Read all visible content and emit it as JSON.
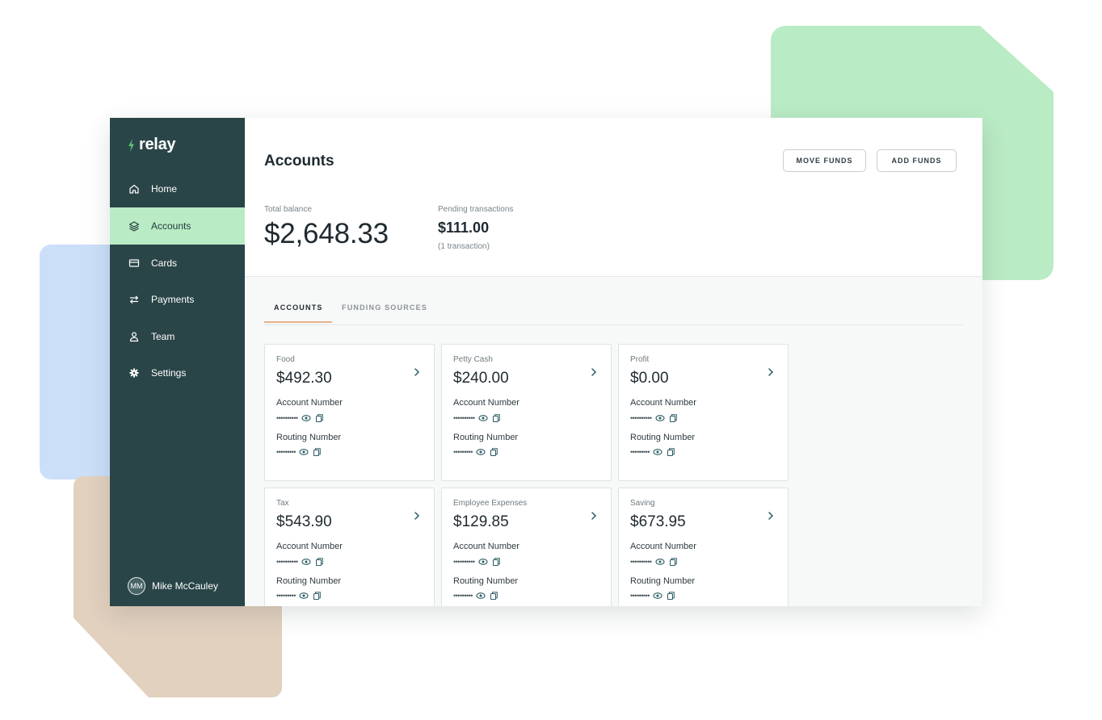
{
  "brand": {
    "name": "relay",
    "accent": "#5cc36f"
  },
  "sidebar": {
    "background": "#2a4548",
    "active_color": "#b9ebc4",
    "items": [
      {
        "label": "Home",
        "icon": "home-icon"
      },
      {
        "label": "Accounts",
        "icon": "layers-icon",
        "active": true
      },
      {
        "label": "Cards",
        "icon": "card-icon"
      },
      {
        "label": "Payments",
        "icon": "transfer-icon"
      },
      {
        "label": "Team",
        "icon": "person-icon"
      },
      {
        "label": "Settings",
        "icon": "gear-icon"
      }
    ],
    "user": {
      "initials": "MM",
      "name": "Mike McCauley"
    }
  },
  "header": {
    "title": "Accounts",
    "move_funds_label": "MOVE FUNDS",
    "add_funds_label": "ADD FUNDS",
    "total_balance_label": "Total balance",
    "total_balance_value": "$2,648.33",
    "pending_label": "Pending transactions",
    "pending_value": "$111.00",
    "pending_note": "(1 transaction)"
  },
  "tabs": [
    {
      "label": "ACCOUNTS",
      "active": true
    },
    {
      "label": "FUNDING SOURCES",
      "active": false
    }
  ],
  "accounts": [
    {
      "name": "Food",
      "balance": "$492.30",
      "account_label": "Account Number",
      "account_masked": "••••••••••",
      "routing_label": "Routing Number",
      "routing_masked": "•••••••••"
    },
    {
      "name": "Petty Cash",
      "balance": "$240.00",
      "account_label": "Account Number",
      "account_masked": "••••••••••",
      "routing_label": "Routing Number",
      "routing_masked": "•••••••••"
    },
    {
      "name": "Profit",
      "balance": "$0.00",
      "account_label": "Account Number",
      "account_masked": "••••••••••",
      "routing_label": "Routing Number",
      "routing_masked": "•••••••••"
    },
    {
      "name": "Tax",
      "balance": "$543.90",
      "account_label": "Account Number",
      "account_masked": "••••••••••",
      "routing_label": "Routing Number",
      "routing_masked": "•••••••••"
    },
    {
      "name": "Employee Expenses",
      "balance": "$129.85",
      "account_label": "Account Number",
      "account_masked": "••••••••••",
      "routing_label": "Routing Number",
      "routing_masked": "•••••••••"
    },
    {
      "name": "Saving",
      "balance": "$673.95",
      "account_label": "Account Number",
      "account_masked": "••••••••••",
      "routing_label": "Routing Number",
      "routing_masked": "•••••••••"
    }
  ]
}
